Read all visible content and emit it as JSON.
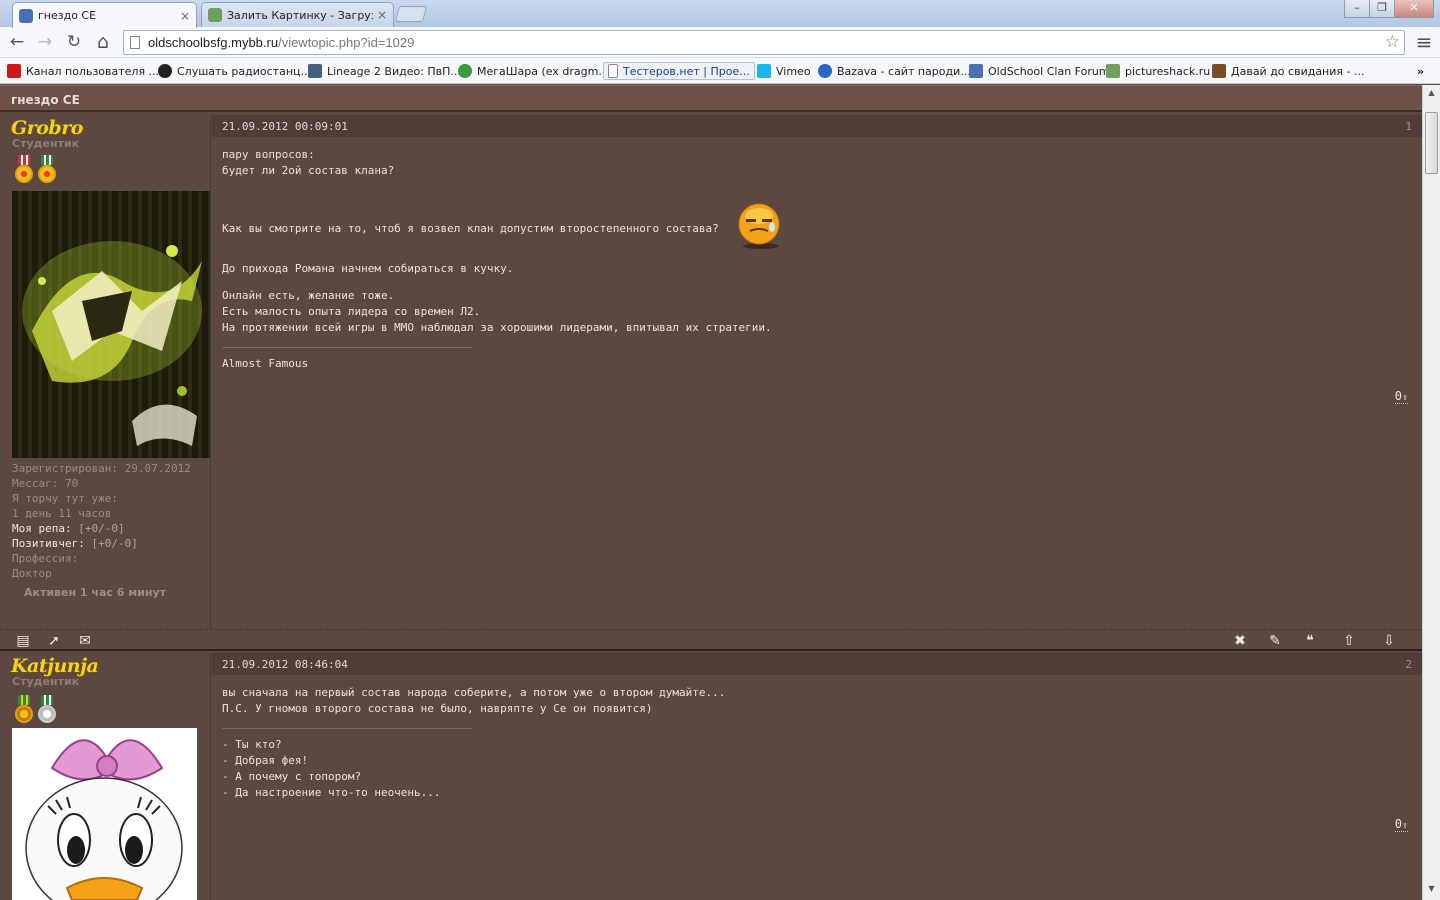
{
  "browser": {
    "tabs": [
      {
        "title": "гнездо CE",
        "close": "×",
        "favicon_color": "#4a6fb5"
      },
      {
        "title": "Залить Картинку - Загрузить",
        "close": "×",
        "favicon_color": "#6fa05a"
      }
    ],
    "window_controls": {
      "minimize": "–",
      "restore": "❐",
      "close": "✕"
    },
    "nav": {
      "back": "←",
      "forward": "→",
      "reload": "↻",
      "home": "⌂",
      "menu": "≡"
    },
    "url_host": "oldschoolbsfg.mybb.ru",
    "url_path": "/viewtopic.php?id=1029",
    "star": "☆",
    "bookmarks": [
      {
        "label": "Канал пользователя ...",
        "icon": "youtube-icon",
        "color": "#cc1a1a"
      },
      {
        "label": "Слушать радиостанц...",
        "icon": "paw-icon",
        "color": "#222222"
      },
      {
        "label": "Lineage 2 Видео: ПвП...",
        "icon": "lineage-icon",
        "color": "#45607a"
      },
      {
        "label": "МегаШара (ex dragm...",
        "icon": "megashara-icon",
        "color": "#3a9b3a"
      },
      {
        "label": "Тестеров.нет | Прое...",
        "icon": "page-icon",
        "color": "#ffffff"
      },
      {
        "label": "Vimeo",
        "icon": "vimeo-icon",
        "color": "#1ab7ea"
      },
      {
        "label": "Bazava - сайт пароди...",
        "icon": "bazava-icon",
        "color": "#2a67c2"
      },
      {
        "label": "OldSchool Clan Forum",
        "icon": "forum-icon",
        "color": "#4a6fb5"
      },
      {
        "label": "pictureshack.ru",
        "icon": "pictureshack-icon",
        "color": "#6fa05a"
      },
      {
        "label": "Давай до свидания - ...",
        "icon": "ta-icon",
        "color": "#7a4d2a"
      }
    ],
    "overflow": "»"
  },
  "forum": {
    "header_title": "гнездо CE",
    "posts": [
      {
        "username": "Grobro",
        "rank": "Студентик",
        "info": {
          "registered": "Зарегистрирован: 29.07.2012",
          "messages": "Мессаг: 70",
          "time_label": "Я торчу тут уже:",
          "time_value": "1 день 11 часов",
          "rep_label": "Моя репа:",
          "rep_value": "[+0/-0]",
          "pos_label": "Позитивчег:",
          "pos_value": "[+0/-0]",
          "prof_label": "Профессия:",
          "prof_value": "Доктор"
        },
        "active": "Активен 1 час 6 минут",
        "date": "21.09.2012 00:09:01",
        "number": "1",
        "paragraphs": [
          [
            "пару вопросов:",
            "будет ли 2ой состав клана?"
          ],
          [
            "Как вы смотрите на то, чтоб я возвел клан допустим второстепенного состава?"
          ],
          [
            "До прихода Романа начнем собираться в кучку."
          ],
          [
            "Онлайн есть, желание тоже.",
            "Есть малость опыта лидера со времен Л2.",
            "На протяжении всей игры в ММО наблюдал за хорошими лидерами, впитывал их стратегии."
          ]
        ],
        "signature": [
          "Almost Famous"
        ],
        "rating": "0"
      },
      {
        "username": "Katjunja",
        "rank": "Студентик",
        "date": "21.09.2012 08:46:04",
        "number": "2",
        "paragraphs": [
          [
            "вы сначала на первый состав народа соберите, а потом уже о втором думайте...",
            "П.С. У гномов второго состава не было, навряпте у Се он появится)"
          ]
        ],
        "signature": [
          "- Ты кто?",
          "- Добрая фея!",
          "- А почему с топором?",
          "- Да настроение что-то неочень..."
        ],
        "rating": "0"
      }
    ],
    "footer_left_icons": [
      "profile-icon",
      "pointer-icon",
      "email-icon"
    ],
    "footer_right_icons": [
      "delete-icon",
      "edit-icon",
      "quote-icon",
      "up-icon",
      "down-icon"
    ],
    "footer_glyphs": {
      "profile": "▤",
      "pointer": "➚",
      "email": "✉",
      "delete": "✖",
      "edit": "✎",
      "quote": "❝",
      "up": "⇧",
      "down": "⇩"
    },
    "rating_arrow": "⇪"
  },
  "colors": {
    "page_bg": "#5c4741",
    "username": "#f3d31b",
    "post_text": "#ece3de"
  }
}
